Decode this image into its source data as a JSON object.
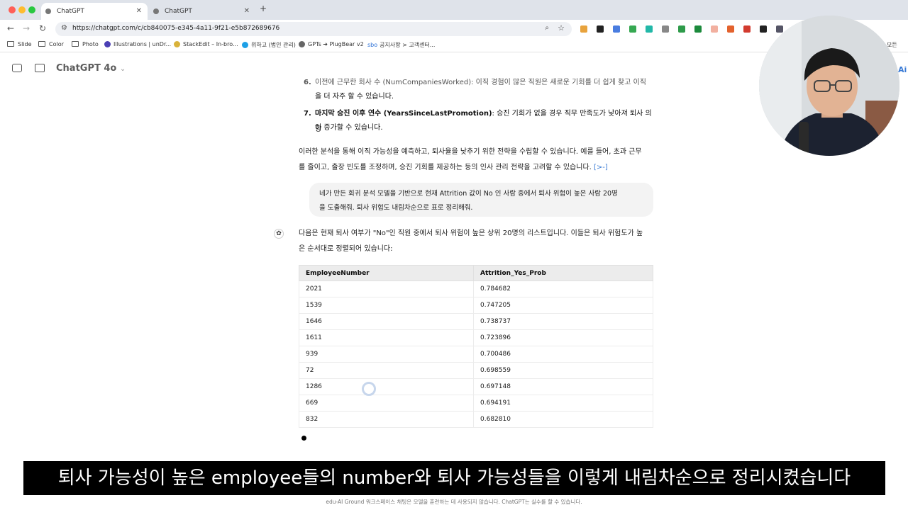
{
  "browser": {
    "tabs": [
      {
        "title": "ChatGPT",
        "active": true
      },
      {
        "title": "ChatGPT",
        "active": false
      }
    ],
    "new_tab": "+",
    "url": "https://chatgpt.com/c/cb840075-e345-4a11-9f21-e5b872689676",
    "bookmarks": [
      "Slide",
      "Color",
      "Photo",
      "Illustrations | unDr...",
      "StackEdit – In-bro...",
      "위하고 (법인 관리)",
      "GPTs ➜ PlugBear v2",
      "공지사항 > 고객센터...",
      "모든"
    ],
    "bookmark_prefix": "sbo"
  },
  "app": {
    "model_label": "ChatGPT 4o",
    "right_cut_label": "Ai"
  },
  "conversation": {
    "item6_line1": "이전에 근무한 회사 수 (NumCompaniesWorked): 이직 경험이 많은 직원은 새로운 기회를 더 쉽게 찾고 이직",
    "item6_line2": "을 더 자주 할 수 있습니다.",
    "item7_num": "7.",
    "item7_bold": "마지막 승진 이후 연수 (YearsSinceLastPromotion)",
    "item7_rest": ": 승진 기회가 없을 경우 직무 만족도가 낮아져 퇴사 의향",
    "item7_line2": "이 증가할 수 있습니다.",
    "summary_line1": "이러한 분석을 통해 이직 가능성을 예측하고, 퇴사율을 낮추기 위한 전략을 수립할 수 있습니다. 예를 들어, 초과 근무",
    "summary_line2": "를 줄이고, 출장 빈도를 조정하며, 승진 기회를 제공하는 등의 인사 관리 전략을 고려할 수 있습니다.",
    "summary_cite": "[>-]",
    "user_line1": "네가 만든 회귀 분석 모델을 기반으로 현재 Attrition 값이 No 인 사람 중에서 퇴사 위험이 높은 사람 20명",
    "user_line2": "을 도출해줘. 퇴사 위험도 내림차순으로 표로 정리해줘.",
    "reply_line1": "다음은 현재 퇴사 여부가 \"No\"인 직원 중에서 퇴사 위험이 높은 상위 20명의 리스트입니다. 이들은 퇴사 위험도가 높",
    "reply_line2": "은 순서대로 정렬되어 있습니다:"
  },
  "table": {
    "headers": [
      "EmployeeNumber",
      "Attrition_Yes_Prob"
    ],
    "rows": [
      [
        "2021",
        "0.784682"
      ],
      [
        "1539",
        "0.747205"
      ],
      [
        "1646",
        "0.738737"
      ],
      [
        "1611",
        "0.723896"
      ],
      [
        "939",
        "0.700486"
      ],
      [
        "72",
        "0.698559"
      ],
      [
        "1286",
        "0.697148"
      ],
      [
        "669",
        "0.694191"
      ],
      [
        "832",
        "0.682810"
      ]
    ]
  },
  "subtitle": "퇴사 가능성이 높은 employee들의 number와 퇴사 가능성들을 이렇게 내림차순으로 정리시켰습니다",
  "footer": "edu-AI Ground 워크스페이스 채팅은 모델을 훈련하는 데 사용되지 않습니다. ChatGPT는 실수를 할 수 있습니다.",
  "colors": {
    "accent": "#3a7bd5",
    "traffic_red": "#ff5f57",
    "traffic_yellow": "#febc2e",
    "traffic_green": "#28c840"
  }
}
